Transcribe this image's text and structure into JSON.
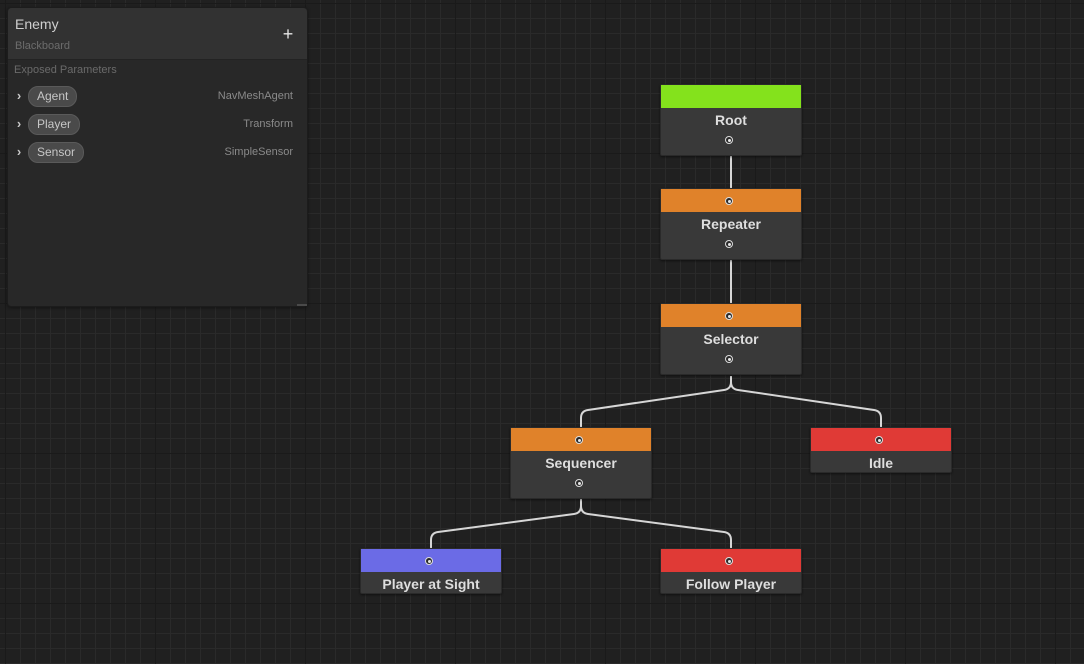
{
  "blackboard": {
    "title": "Enemy",
    "subtitle": "Blackboard",
    "add_label": "+",
    "section_label": "Exposed Parameters",
    "parameters": [
      {
        "name": "Agent",
        "type": "NavMeshAgent"
      },
      {
        "name": "Player",
        "type": "Transform"
      },
      {
        "name": "Sensor",
        "type": "SimpleSensor"
      }
    ]
  },
  "nodes": {
    "root": {
      "label": "Root",
      "color": "#84e21c"
    },
    "repeater": {
      "label": "Repeater",
      "color": "#e0822a"
    },
    "selector": {
      "label": "Selector",
      "color": "#e0822a"
    },
    "sequencer": {
      "label": "Sequencer",
      "color": "#e0822a"
    },
    "idle": {
      "label": "Idle",
      "color": "#e03a36"
    },
    "player_at_sight": {
      "label": "Player at Sight",
      "color": "#6b6be6"
    },
    "follow_player": {
      "label": "Follow Player",
      "color": "#e03a36"
    }
  },
  "icons": {
    "expand": "chevron-right-icon",
    "add": "plus-icon",
    "port": "port-dot-icon"
  }
}
